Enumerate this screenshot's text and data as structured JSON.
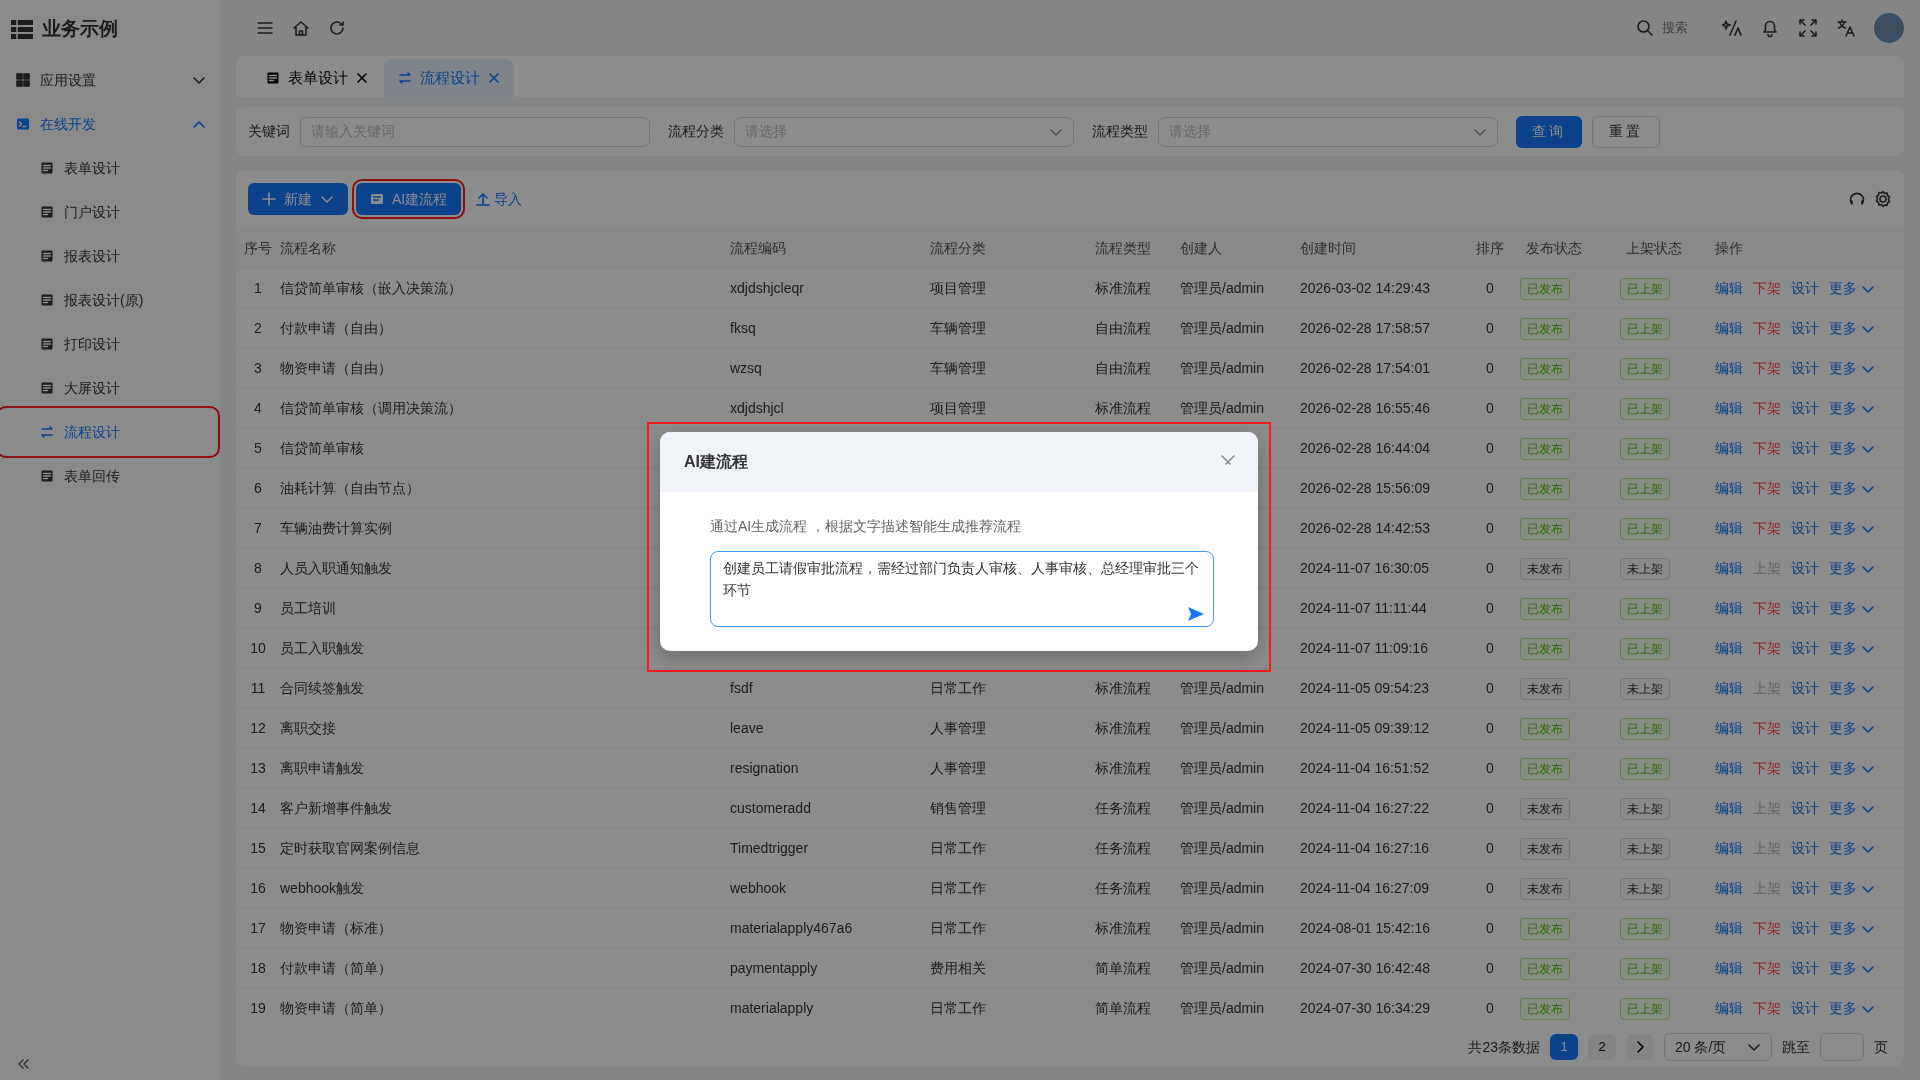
{
  "app": {
    "title": "业务示例"
  },
  "header": {
    "search_placeholder": "搜索"
  },
  "sidebar": {
    "groups": [
      {
        "label": "应用设置",
        "expanded": false,
        "selected": false
      },
      {
        "label": "在线开发",
        "expanded": true,
        "selected": true,
        "children": [
          {
            "label": "表单设计",
            "selected": false,
            "highlighted": false
          },
          {
            "label": "门户设计",
            "selected": false,
            "highlighted": false
          },
          {
            "label": "报表设计",
            "selected": false,
            "highlighted": false
          },
          {
            "label": "报表设计(原)",
            "selected": false,
            "highlighted": false
          },
          {
            "label": "打印设计",
            "selected": false,
            "highlighted": false
          },
          {
            "label": "大屏设计",
            "selected": false,
            "highlighted": false
          },
          {
            "label": "流程设计",
            "selected": true,
            "highlighted": true
          },
          {
            "label": "表单回传",
            "selected": false,
            "highlighted": false
          }
        ]
      }
    ]
  },
  "tabs": [
    {
      "label": "表单设计",
      "selected": false
    },
    {
      "label": "流程设计",
      "selected": true
    }
  ],
  "filters": [
    {
      "label": "关键词",
      "kind": "input",
      "placeholder": "请输入关键词"
    },
    {
      "label": "流程分类",
      "kind": "select",
      "placeholder": "请选择"
    },
    {
      "label": "流程类型",
      "kind": "select",
      "placeholder": "请选择"
    }
  ],
  "filter_buttons": [
    {
      "label": "查询",
      "primary": true
    },
    {
      "label": "重置",
      "primary": false
    }
  ],
  "toolbar": [
    {
      "label": "新建",
      "kind": "dropdown",
      "highlighted": false
    },
    {
      "label": "AI建流程",
      "kind": "primary",
      "highlighted": true
    },
    {
      "label": "导入",
      "kind": "link",
      "highlighted": false
    }
  ],
  "table": {
    "columns": [
      "序号",
      "流程名称",
      "流程编码",
      "流程分类",
      "流程类型",
      "创建人",
      "创建时间",
      "排序",
      "发布状态",
      "上架状态",
      "操作"
    ],
    "rows": [
      {
        "no": "1",
        "name": "信贷简单审核（嵌入决策流）",
        "code": "xdjdshjcleqr",
        "category": "项目管理",
        "type": "标准流程",
        "creator": "管理员/admin",
        "time": "2026-03-02 14:29:43",
        "sort": "0",
        "publish": {
          "label": "已发布",
          "on": true
        },
        "listing": {
          "label": "已上架",
          "on": true
        },
        "actions": [
          "编辑",
          "下架",
          "设计",
          "更多"
        ],
        "toggle_disabled": false
      },
      {
        "no": "2",
        "name": "付款申请（自由）",
        "code": "fksq",
        "category": "车辆管理",
        "type": "自由流程",
        "creator": "管理员/admin",
        "time": "2026-02-28 17:58:57",
        "sort": "0",
        "publish": {
          "label": "已发布",
          "on": true
        },
        "listing": {
          "label": "已上架",
          "on": true
        },
        "actions": [
          "编辑",
          "下架",
          "设计",
          "更多"
        ],
        "toggle_disabled": false
      },
      {
        "no": "3",
        "name": "物资申请（自由）",
        "code": "wzsq",
        "category": "车辆管理",
        "type": "自由流程",
        "creator": "管理员/admin",
        "time": "2026-02-28 17:54:01",
        "sort": "0",
        "publish": {
          "label": "已发布",
          "on": true
        },
        "listing": {
          "label": "已上架",
          "on": true
        },
        "actions": [
          "编辑",
          "下架",
          "设计",
          "更多"
        ],
        "toggle_disabled": false
      },
      {
        "no": "4",
        "name": "信贷简单审核（调用决策流）",
        "code": "xdjdshjcl",
        "category": "项目管理",
        "type": "标准流程",
        "creator": "管理员/admin",
        "time": "2026-02-28 16:55:46",
        "sort": "0",
        "publish": {
          "label": "已发布",
          "on": true
        },
        "listing": {
          "label": "已上架",
          "on": true
        },
        "actions": [
          "编辑",
          "下架",
          "设计",
          "更多"
        ],
        "toggle_disabled": false
      },
      {
        "no": "5",
        "name": "信贷简单审核",
        "time": "2026-02-28 16:44:04",
        "sort": "0",
        "publish": {
          "label": "已发布",
          "on": true
        },
        "listing": {
          "label": "已上架",
          "on": true
        },
        "actions": [
          "编辑",
          "下架",
          "设计",
          "更多"
        ],
        "toggle_disabled": false
      },
      {
        "no": "6",
        "name": "油耗计算（自由节点）",
        "time": "2026-02-28 15:56:09",
        "sort": "0",
        "publish": {
          "label": "已发布",
          "on": true
        },
        "listing": {
          "label": "已上架",
          "on": true
        },
        "actions": [
          "编辑",
          "下架",
          "设计",
          "更多"
        ],
        "toggle_disabled": false
      },
      {
        "no": "7",
        "name": "车辆油费计算实例",
        "time": "2026-02-28 14:42:53",
        "sort": "0",
        "publish": {
          "label": "已发布",
          "on": true
        },
        "listing": {
          "label": "已上架",
          "on": true
        },
        "actions": [
          "编辑",
          "下架",
          "设计",
          "更多"
        ],
        "toggle_disabled": false
      },
      {
        "no": "8",
        "name": "人员入职通知触发",
        "time": "2024-11-07 16:30:05",
        "sort": "0",
        "publish": {
          "label": "未发布",
          "on": false
        },
        "listing": {
          "label": "未上架",
          "on": false
        },
        "actions": [
          "编辑",
          "上架",
          "设计",
          "更多"
        ],
        "toggle_disabled": true
      },
      {
        "no": "9",
        "name": "员工培训",
        "time": "2024-11-07 11:11:44",
        "sort": "0",
        "publish": {
          "label": "已发布",
          "on": true
        },
        "listing": {
          "label": "已上架",
          "on": true
        },
        "actions": [
          "编辑",
          "下架",
          "设计",
          "更多"
        ],
        "toggle_disabled": false
      },
      {
        "no": "10",
        "name": "员工入职触发",
        "time": "2024-11-07 11:09:16",
        "sort": "0",
        "publish": {
          "label": "已发布",
          "on": true
        },
        "listing": {
          "label": "已上架",
          "on": true
        },
        "actions": [
          "编辑",
          "下架",
          "设计",
          "更多"
        ],
        "toggle_disabled": false
      },
      {
        "no": "11",
        "name": "合同续签触发",
        "code": "fsdf",
        "category": "日常工作",
        "type": "标准流程",
        "creator": "管理员/admin",
        "time": "2024-11-05 09:54:23",
        "sort": "0",
        "publish": {
          "label": "未发布",
          "on": false
        },
        "listing": {
          "label": "未上架",
          "on": false
        },
        "actions": [
          "编辑",
          "上架",
          "设计",
          "更多"
        ],
        "toggle_disabled": true
      },
      {
        "no": "12",
        "name": "离职交接",
        "code": "leave",
        "category": "人事管理",
        "type": "标准流程",
        "creator": "管理员/admin",
        "time": "2024-11-05 09:39:12",
        "sort": "0",
        "publish": {
          "label": "已发布",
          "on": true
        },
        "listing": {
          "label": "已上架",
          "on": true
        },
        "actions": [
          "编辑",
          "下架",
          "设计",
          "更多"
        ],
        "toggle_disabled": false
      },
      {
        "no": "13",
        "name": "离职申请触发",
        "code": "resignation",
        "category": "人事管理",
        "type": "标准流程",
        "creator": "管理员/admin",
        "time": "2024-11-04 16:51:52",
        "sort": "0",
        "publish": {
          "label": "已发布",
          "on": true
        },
        "listing": {
          "label": "已上架",
          "on": true
        },
        "actions": [
          "编辑",
          "下架",
          "设计",
          "更多"
        ],
        "toggle_disabled": false
      },
      {
        "no": "14",
        "name": "客户新增事件触发",
        "code": "customeradd",
        "category": "销售管理",
        "type": "任务流程",
        "creator": "管理员/admin",
        "time": "2024-11-04 16:27:22",
        "sort": "0",
        "publish": {
          "label": "未发布",
          "on": false
        },
        "listing": {
          "label": "未上架",
          "on": false
        },
        "actions": [
          "编辑",
          "上架",
          "设计",
          "更多"
        ],
        "toggle_disabled": true
      },
      {
        "no": "15",
        "name": "定时获取官网案例信息",
        "code": "Timedtrigger",
        "category": "日常工作",
        "type": "任务流程",
        "creator": "管理员/admin",
        "time": "2024-11-04 16:27:16",
        "sort": "0",
        "publish": {
          "label": "未发布",
          "on": false
        },
        "listing": {
          "label": "未上架",
          "on": false
        },
        "actions": [
          "编辑",
          "上架",
          "设计",
          "更多"
        ],
        "toggle_disabled": true
      },
      {
        "no": "16",
        "name": "webhook触发",
        "code": "webhook",
        "category": "日常工作",
        "type": "任务流程",
        "creator": "管理员/admin",
        "time": "2024-11-04 16:27:09",
        "sort": "0",
        "publish": {
          "label": "未发布",
          "on": false
        },
        "listing": {
          "label": "未上架",
          "on": false
        },
        "actions": [
          "编辑",
          "上架",
          "设计",
          "更多"
        ],
        "toggle_disabled": true
      },
      {
        "no": "17",
        "name": "物资申请（标准）",
        "code": "materialapply467a6",
        "category": "日常工作",
        "type": "标准流程",
        "creator": "管理员/admin",
        "time": "2024-08-01 15:42:16",
        "sort": "0",
        "publish": {
          "label": "已发布",
          "on": true
        },
        "listing": {
          "label": "已上架",
          "on": true
        },
        "actions": [
          "编辑",
          "下架",
          "设计",
          "更多"
        ],
        "toggle_disabled": false
      },
      {
        "no": "18",
        "name": "付款申请（简单）",
        "code": "paymentapply",
        "category": "费用相关",
        "type": "简单流程",
        "creator": "管理员/admin",
        "time": "2024-07-30 16:42:48",
        "sort": "0",
        "publish": {
          "label": "已发布",
          "on": true
        },
        "listing": {
          "label": "已上架",
          "on": true
        },
        "actions": [
          "编辑",
          "下架",
          "设计",
          "更多"
        ],
        "toggle_disabled": false
      },
      {
        "no": "19",
        "name": "物资申请（简单）",
        "code": "materialapply",
        "category": "日常工作",
        "type": "简单流程",
        "creator": "管理员/admin",
        "time": "2024-07-30 16:34:29",
        "sort": "0",
        "publish": {
          "label": "已发布",
          "on": true
        },
        "listing": {
          "label": "已上架",
          "on": true
        },
        "actions": [
          "编辑",
          "下架",
          "设计",
          "更多"
        ],
        "toggle_disabled": false
      }
    ]
  },
  "pagination": {
    "summary": "共23条数据",
    "pages": [
      {
        "label": "1",
        "selected": true
      },
      {
        "label": "2",
        "selected": false
      }
    ],
    "page_size": "20 条/页",
    "jump_label": "跳至",
    "page_unit": "页"
  },
  "modal": {
    "title": "AI建流程",
    "hint": "通过AI生成流程 ，根据文字描述智能生成推荐流程",
    "value": "创建员工请假审批流程，需经过部门负责人审核、人事审核、总经理审批三个环节",
    "highlighted": true
  }
}
